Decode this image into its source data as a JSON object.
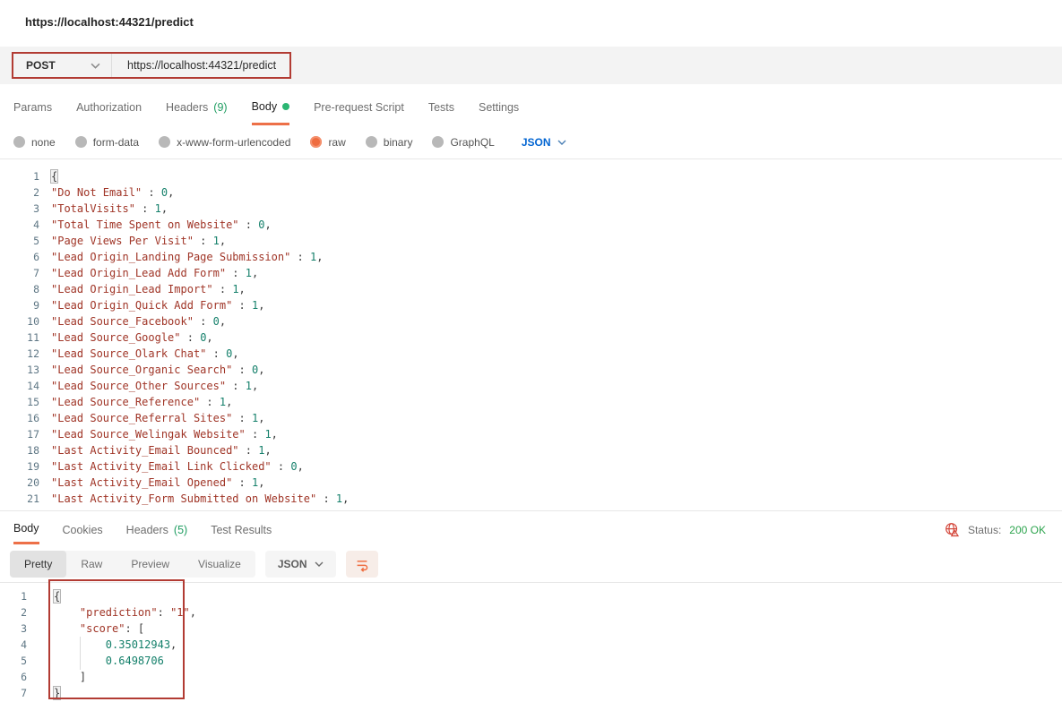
{
  "colors": {
    "accent_orange": "#ef6c3f",
    "link_blue": "#0265d2",
    "success_green": "#2da44e",
    "annotation_red": "#b23b33"
  },
  "window": {
    "tab_title": "https://localhost:44321/predict"
  },
  "request": {
    "method": "POST",
    "url": "https://localhost:44321/predict",
    "tabs": [
      {
        "label": "Params"
      },
      {
        "label": "Authorization"
      },
      {
        "label": "Headers",
        "count": "(9)"
      },
      {
        "label": "Body"
      },
      {
        "label": "Pre-request Script"
      },
      {
        "label": "Tests"
      },
      {
        "label": "Settings"
      }
    ],
    "body_modes": [
      {
        "label": "none"
      },
      {
        "label": "form-data"
      },
      {
        "label": "x-www-form-urlencoded"
      },
      {
        "label": "raw"
      },
      {
        "label": "binary"
      },
      {
        "label": "GraphQL"
      }
    ],
    "selected_mode": "raw",
    "language": "JSON",
    "code_lines": [
      "{",
      "\"Do Not Email\" : 0,",
      "\"TotalVisits\" : 1,",
      "\"Total Time Spent on Website\" : 0,",
      "\"Page Views Per Visit\" : 1,",
      "\"Lead Origin_Landing Page Submission\" : 1,",
      "\"Lead Origin_Lead Add Form\" : 1,",
      "\"Lead Origin_Lead Import\" : 1,",
      "\"Lead Origin_Quick Add Form\" : 1,",
      "\"Lead Source_Facebook\" : 0,",
      "\"Lead Source_Google\" : 0,",
      "\"Lead Source_Olark Chat\" : 0,",
      "\"Lead Source_Organic Search\" : 0,",
      "\"Lead Source_Other Sources\" : 1,",
      "\"Lead Source_Reference\" : 1,",
      "\"Lead Source_Referral Sites\" : 1,",
      "\"Lead Source_Welingak Website\" : 1,",
      "\"Last Activity_Email Bounced\" : 1,",
      "\"Last Activity_Email Link Clicked\" : 0,",
      "\"Last Activity_Email Opened\" : 1,",
      "\"Last Activity_Form Submitted on Website\" : 1,"
    ]
  },
  "response": {
    "tabs": [
      {
        "label": "Body"
      },
      {
        "label": "Cookies"
      },
      {
        "label": "Headers",
        "count": "(5)"
      },
      {
        "label": "Test Results"
      }
    ],
    "status_label": "Status:",
    "status_value": "200 OK",
    "views": [
      {
        "label": "Pretty"
      },
      {
        "label": "Raw"
      },
      {
        "label": "Preview"
      },
      {
        "label": "Visualize"
      }
    ],
    "language": "JSON",
    "code_lines": [
      "{",
      "    \"prediction\": \"1\",",
      "    \"score\": [",
      "        0.35012943,",
      "        0.6498706",
      "    ]",
      "}"
    ]
  }
}
